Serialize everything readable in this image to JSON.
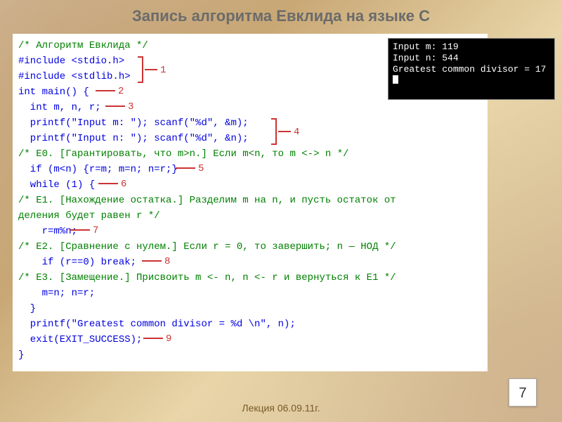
{
  "title": "Запись алгоритма Евклида на языке С",
  "footer": "Лекция 06.09.11г.",
  "page_number": "7",
  "terminal": {
    "line1": "Input m: 119",
    "line2": "Input n: 544",
    "line3": "Greatest common divisor = 17"
  },
  "code": {
    "l1": "/* Алгоритм Евклида */",
    "l2": "#include <stdio.h>",
    "l3": "#include <stdlib.h>",
    "l4": "int main() {",
    "l5": "  int m, n, r;",
    "l6": "  printf(\"Input m: \"); scanf(\"%d\", &m);",
    "l7": "  printf(\"Input n: \"); scanf(\"%d\", &n);",
    "l8a": "/* E0. [Гарантировать, что m>n.] Если m",
    "l8b": "<",
    "l8c": "n, то m ",
    "l8d": "<->",
    "l8e": " n */",
    "l9": "  if (m<n) {r=m; m=n; n=r;}",
    "l10": "  while (1) {",
    "l11": "/* E1. [Нахождение остатка.] Разделим m на n, и пусть остаток от",
    "l12": "деления будет равен r */",
    "l13": "    r=m%n;",
    "l14": "/* E2. [Сравнение с нулем.] Если r = 0, то завершить; n — НОД */",
    "l15": "    if (r==0) break;",
    "l16": "/* E3. [Замещение.] Присвоить m <- n, n <- r и вернуться к E1 */",
    "l17": "    m=n; n=r;",
    "l18": "  }",
    "l19": "  printf(\"Greatest common divisor = %d \\n\", n);",
    "l20": "  exit(EXIT_SUCCESS);",
    "l21": "}"
  },
  "annotations": {
    "a1": "1",
    "a2": "2",
    "a3": "3",
    "a4": "4",
    "a5": "5",
    "a6": "6",
    "a7": "7",
    "a8": "8",
    "a9": "9"
  }
}
